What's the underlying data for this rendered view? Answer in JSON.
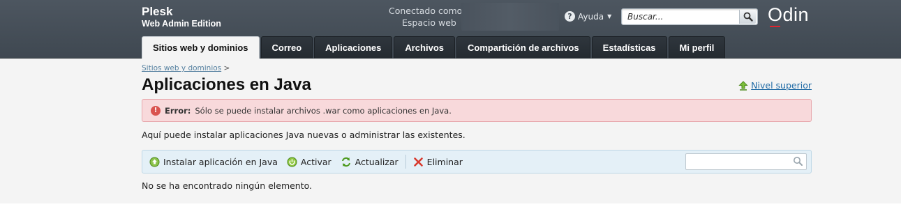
{
  "brand": {
    "name": "Plesk",
    "edition": "Web Admin Edition",
    "vendor_logo": "Odin"
  },
  "login": {
    "line1": "Conectado como",
    "line2": "Espacio web"
  },
  "help": {
    "label": "Ayuda"
  },
  "search": {
    "placeholder": "Buscar..."
  },
  "tabs": [
    {
      "label": "Sitios web y dominios"
    },
    {
      "label": "Correo"
    },
    {
      "label": "Aplicaciones"
    },
    {
      "label": "Archivos"
    },
    {
      "label": "Compartición de archivos"
    },
    {
      "label": "Estadísticas"
    },
    {
      "label": "Mi perfil"
    }
  ],
  "breadcrumb": {
    "link": "Sitios web y dominios",
    "separator": ">"
  },
  "page": {
    "title": "Aplicaciones en Java",
    "up_level": "Nivel superior",
    "error_label": "Error:",
    "error_message": "Sólo se puede instalar archivos .war como aplicaciones en Java.",
    "hint": "Aquí puede instalar aplicaciones Java nuevas o administrar las existentes.",
    "empty_message": "No se ha encontrado ningún elemento."
  },
  "toolbar": {
    "install": "Instalar aplicación en Java",
    "activate": "Activar",
    "update": "Actualizar",
    "delete": "Eliminar"
  },
  "colors": {
    "header_bg": "#47505a",
    "accent_link": "#1f6aa5",
    "error_bg": "#f8d9db",
    "toolbar_bg": "#e4f0f7"
  },
  "icons": {
    "help": "question-icon",
    "search": "magnifier-icon",
    "up": "arrow-up-icon",
    "error": "exclamation-icon",
    "install": "install-icon",
    "activate": "power-icon",
    "update": "refresh-icon",
    "delete": "delete-x-icon"
  }
}
